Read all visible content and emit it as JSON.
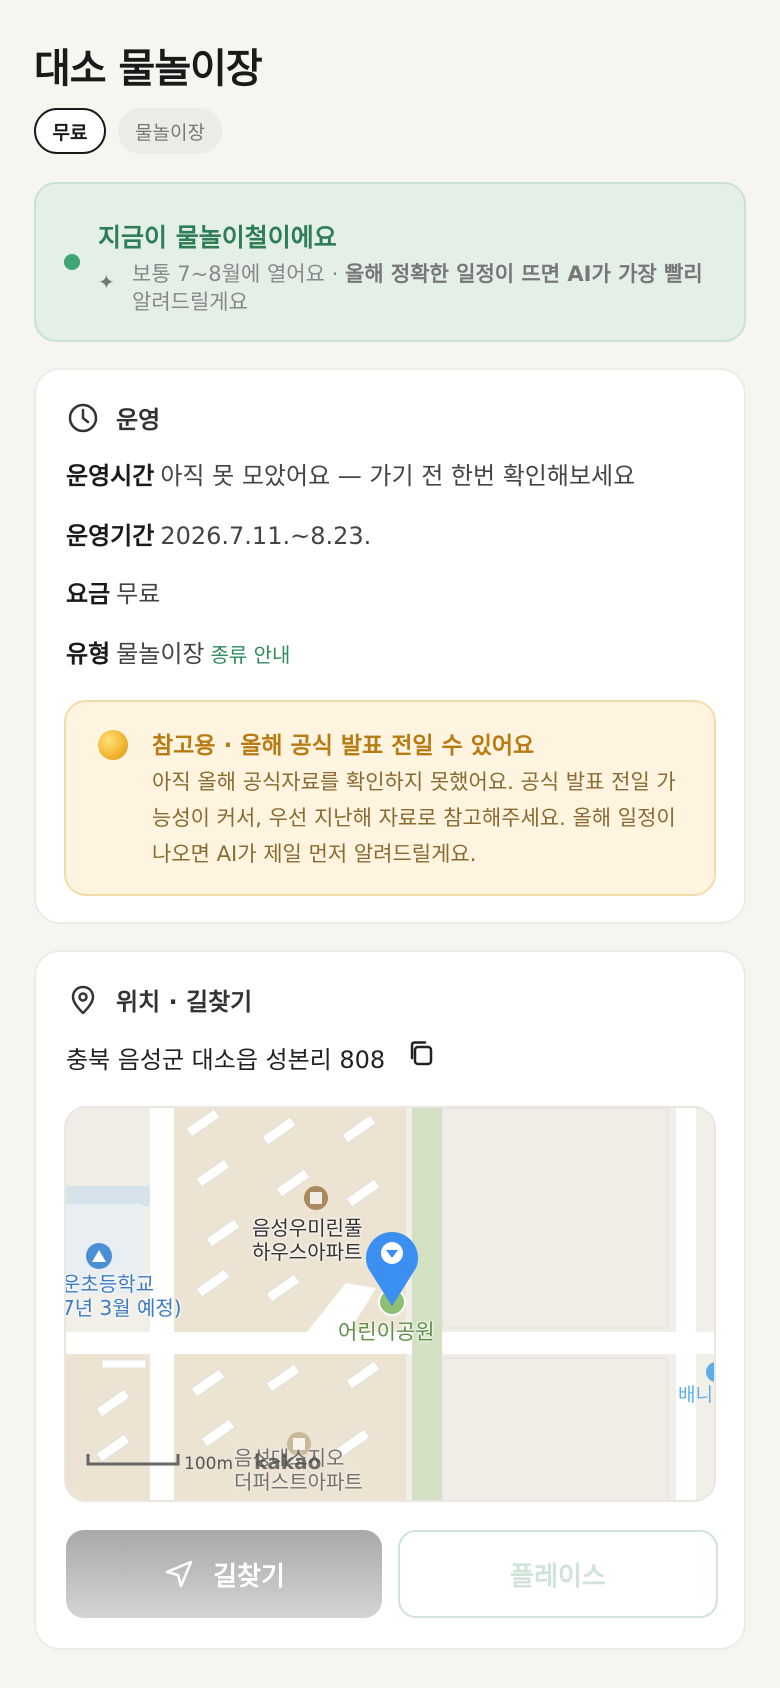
{
  "title": "대소 물놀이장",
  "chips": {
    "fee": "무료",
    "category": "물놀이장"
  },
  "season": {
    "title": "지금이 물놀이철이에요",
    "text_plain": "보통 7~8월에 열어요 · ",
    "text_bold": "올해 정확한 일정이 뜨면 AI가 가장 빨리",
    "text_tail": "알려드릴게요",
    "spark_icon": "sparkle-icon"
  },
  "ops": {
    "heading": "운영",
    "heading_icon": "clock-icon",
    "hours_label": "운영시간",
    "hours_value": "아직 못 모았어요 — 가기 전 한번 확인해보세요",
    "period_label": "운영기간",
    "period_value": "2026.7.11.~8.23.",
    "fee_label": "요금",
    "fee_value": "무료",
    "type_label": "유형",
    "type_value": "물놀이장",
    "type_link": "종류 안내"
  },
  "notice": {
    "title": "참고용 · 올해 공식 발표 전일 수 있어요",
    "body": "아직 올해 공식자료를 확인하지 못했어요. 공식 발표 전일 가능성이 커서, 우선 지난해 자료로 참고해주세요. 올해 일정이 나오면 AI가 제일 먼저 알려드릴게요."
  },
  "location": {
    "heading": "위치 · 길찾기",
    "heading_icon": "location-pin-icon",
    "address": "충북 음성군 대소읍 성본리 808",
    "copy_icon": "copy-icon"
  },
  "map": {
    "labels": {
      "apt1_line1": "음성우미린풀",
      "apt1_line2": "하우스아파트",
      "school_line1": "운초등학교",
      "school_line2": "7년 3월 예정)",
      "park": "어린이공원",
      "apt2_line1": "음성대소지오",
      "apt2_line2": "더퍼스트아파트",
      "right_edge": "배니",
      "scale": "100m",
      "logo": "kakao"
    },
    "colors": {
      "marker": "#3b8ff0",
      "park": "#8fbf75",
      "road": "#ffffff",
      "block": "#ece3d3"
    }
  },
  "buttons": {
    "route": "길찾기",
    "place": "플레이스"
  },
  "colors": {
    "accent_green": "#2f7d55",
    "notice_gold": "#b87a12",
    "background": "#f7f5f0"
  }
}
